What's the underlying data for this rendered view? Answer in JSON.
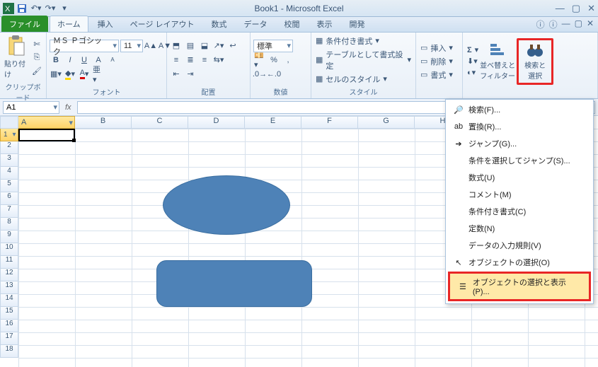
{
  "app": {
    "title": "Book1 - Microsoft Excel"
  },
  "qat": {
    "saveTip": "保存",
    "undoTip": "元に戻す",
    "redoTip": "やり直し"
  },
  "windowButtons": {
    "min": "—",
    "max": "▢",
    "close": "✕"
  },
  "tabs": {
    "file": "ファイル",
    "home": "ホーム",
    "insert": "挿入",
    "pageLayout": "ページ レイアウト",
    "formulas": "数式",
    "data": "データ",
    "review": "校閲",
    "view": "表示",
    "developer": "開発"
  },
  "ribbon": {
    "clipboard": {
      "paste": "貼り付け",
      "label": "クリップボード"
    },
    "font": {
      "name": "ＭＳ Ｐゴシック",
      "size": "11",
      "bold": "B",
      "italic": "I",
      "underline": "U",
      "label": "フォント",
      "sup": "A",
      "sub": "A"
    },
    "align": {
      "label": "配置",
      "normal": "標準"
    },
    "number": {
      "label": "数値"
    },
    "styles": {
      "cond": "条件付き書式",
      "table": "テーブルとして書式設定",
      "cell": "セルのスタイル",
      "label": "スタイル"
    },
    "cells": {
      "insert": "挿入",
      "delete": "削除",
      "format": "書式"
    },
    "editing": {
      "sigma": "Σ",
      "sort": "並べ替えと\nフィルター",
      "find": "検索と\n選択"
    }
  },
  "fx": {
    "cell": "A1",
    "value": ""
  },
  "columns": [
    "A",
    "B",
    "C",
    "D",
    "E",
    "F",
    "G",
    "H"
  ],
  "rows": [
    "1",
    "2",
    "3",
    "4",
    "5",
    "6",
    "7",
    "8",
    "9",
    "10",
    "11",
    "12",
    "13",
    "14",
    "15",
    "16",
    "17",
    "18"
  ],
  "shapes": {
    "ellipseName": "楕円",
    "rectName": "角丸四角形"
  },
  "findMenu": {
    "find": "検索(F)...",
    "replace": "置換(R)...",
    "goto": "ジャンプ(G)...",
    "special": "条件を選択してジャンプ(S)...",
    "formulas": "数式(U)",
    "comments": "コメント(M)",
    "condfmt": "条件付き書式(C)",
    "constants": "定数(N)",
    "validation": "データの入力規則(V)",
    "selobj": "オブジェクトの選択(O)",
    "selpane": "オブジェクトの選択と表示(P)..."
  }
}
